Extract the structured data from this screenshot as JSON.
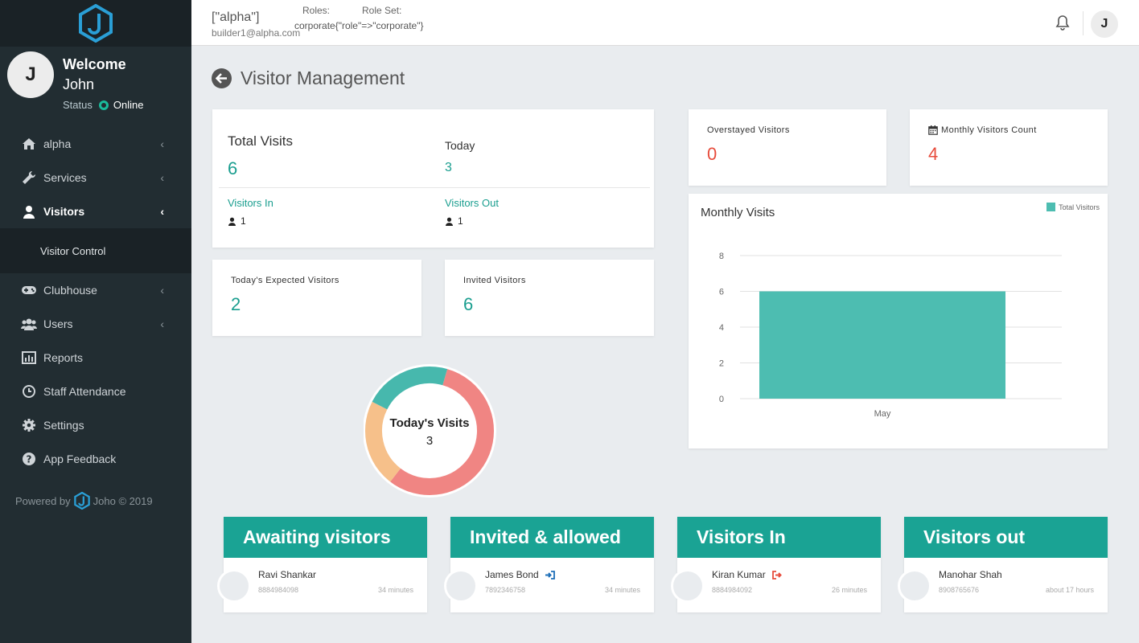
{
  "topbar": {
    "org": "[\"alpha\"]",
    "email": "builder1@alpha.com",
    "roles_label": "Roles:",
    "roleset_label": "Role Set:",
    "corporate": "corporate{\"role\"=>\"corporate\"}",
    "avatar_initial": "J"
  },
  "sidebar": {
    "avatar_initial": "J",
    "welcome": "Welcome",
    "name": "John",
    "status_label": "Status",
    "status_value": "Online",
    "items": [
      {
        "label": "alpha",
        "icon": "home-icon"
      },
      {
        "label": "Services",
        "icon": "wrench-icon"
      },
      {
        "label": "Visitors",
        "icon": "user-icon"
      },
      {
        "label": "Visitor Control"
      },
      {
        "label": "Clubhouse",
        "icon": "gamepad-icon"
      },
      {
        "label": "Users",
        "icon": "users-icon"
      },
      {
        "label": "Reports",
        "icon": "bar-chart-icon"
      },
      {
        "label": "Staff Attendance",
        "icon": "clock-icon"
      },
      {
        "label": "Settings",
        "icon": "gear-icon"
      },
      {
        "label": "App Feedback",
        "icon": "question-icon"
      }
    ],
    "powered_prefix": "Powered by",
    "powered_suffix": "Joho © 2019"
  },
  "page": {
    "title": "Visitor Management"
  },
  "total_card": {
    "total_label": "Total Visits",
    "total_value": "6",
    "today_label": "Today",
    "today_value": "3",
    "in_label": "Visitors In",
    "in_value": "1",
    "out_label": "Visitors Out",
    "out_value": "1"
  },
  "expected_card": {
    "label": "Today's Expected Visitors",
    "value": "2"
  },
  "invited_card": {
    "label": "Invited Visitors",
    "value": "6"
  },
  "overstay_card": {
    "label": "Overstayed Visitors",
    "value": "0"
  },
  "monthly_card": {
    "label": "Monthly Visitors Count",
    "value": "4"
  },
  "donut": {
    "title": "Today's Visits",
    "value": "3",
    "segments": [
      {
        "value": 0.56,
        "color": "#f08583"
      },
      {
        "value": 0.22,
        "color": "#f6c08a"
      },
      {
        "value": 0.22,
        "color": "#47b8ad"
      }
    ]
  },
  "chart_data": {
    "type": "bar",
    "title": "Monthly Visits",
    "categories": [
      "May"
    ],
    "series": [
      {
        "name": "Total Visitors",
        "values": [
          6
        ]
      }
    ],
    "ylim": [
      0,
      8
    ],
    "yticks": [
      "0",
      "2",
      "4",
      "6",
      "8"
    ],
    "color": "#4dbdb1",
    "grid": true,
    "legend": "top-right"
  },
  "panels": [
    {
      "title": "Awaiting visitors",
      "name": "Ravi Shankar",
      "phone": "8884984098",
      "time": "34 minutes"
    },
    {
      "title": "Invited & allowed",
      "name": "James Bond",
      "phone": "7892346758",
      "time": "34 minutes"
    },
    {
      "title": "Visitors In",
      "name": "Kiran Kumar",
      "phone": "8884984092",
      "time": "26 minutes"
    },
    {
      "title": "Visitors out",
      "name": "Manohar Shah",
      "phone": "8908765676",
      "time": "about 17 hours"
    }
  ]
}
